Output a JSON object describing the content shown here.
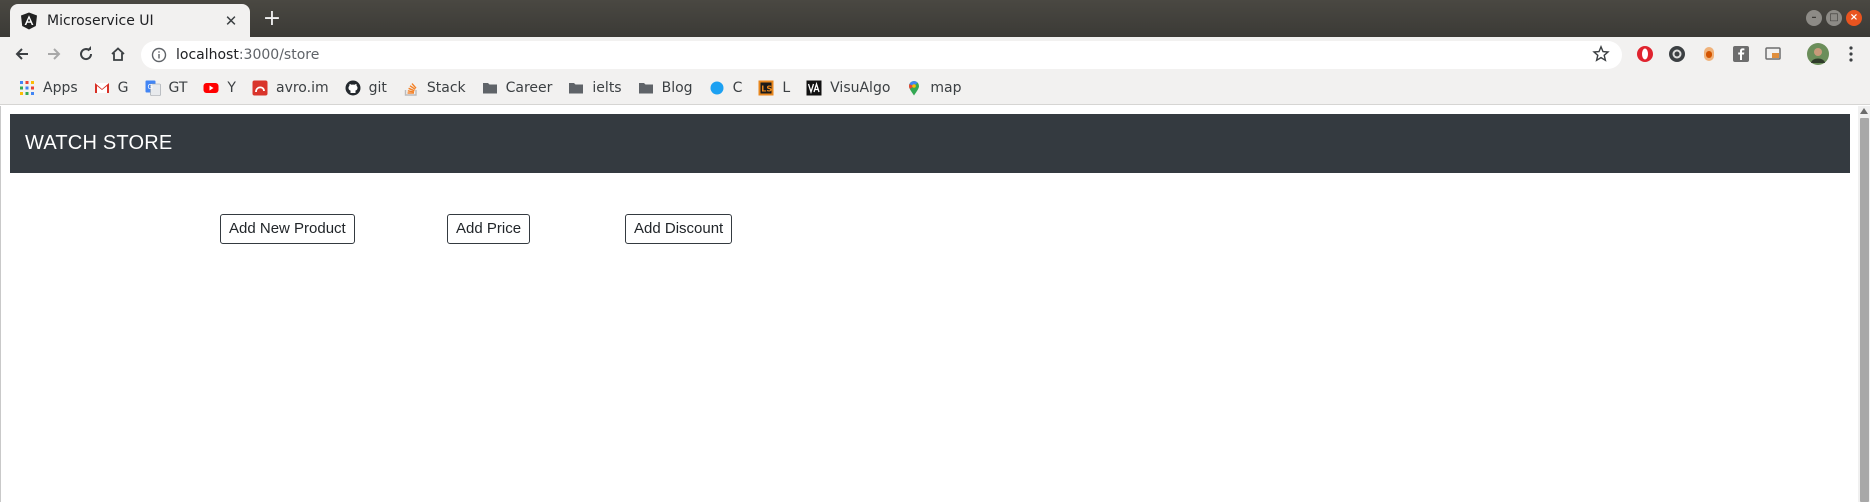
{
  "browser": {
    "tab": {
      "title": "Microservice UI",
      "favicon": "angular-icon"
    },
    "address": {
      "host": "localhost",
      "path": ":3000/store"
    },
    "bookmarks": [
      {
        "label": "Apps",
        "icon": "apps-grid-icon"
      },
      {
        "label": "G",
        "icon": "gmail-icon"
      },
      {
        "label": "GT",
        "icon": "google-translate-icon"
      },
      {
        "label": "Y",
        "icon": "youtube-icon"
      },
      {
        "label": "avro.im",
        "icon": "avro-icon"
      },
      {
        "label": "git",
        "icon": "github-icon"
      },
      {
        "label": "Stack",
        "icon": "stackoverflow-icon"
      },
      {
        "label": "Career",
        "icon": "folder-icon"
      },
      {
        "label": "ielts",
        "icon": "folder-icon"
      },
      {
        "label": "Blog",
        "icon": "folder-icon"
      },
      {
        "label": "C",
        "icon": "circle-blue-icon"
      },
      {
        "label": "L",
        "icon": "leetcode-icon"
      },
      {
        "label": "VisuAlgo",
        "icon": "visualgo-icon"
      },
      {
        "label": "map",
        "icon": "google-maps-icon"
      }
    ]
  },
  "app": {
    "brand": "WATCH STORE",
    "actions": {
      "add_product": "Add New Product",
      "add_price": "Add Price",
      "add_discount": "Add Discount"
    }
  },
  "colors": {
    "navbar": "#343a40",
    "chrome": "#f2f1f0",
    "titlebar": "#3b3a36"
  }
}
